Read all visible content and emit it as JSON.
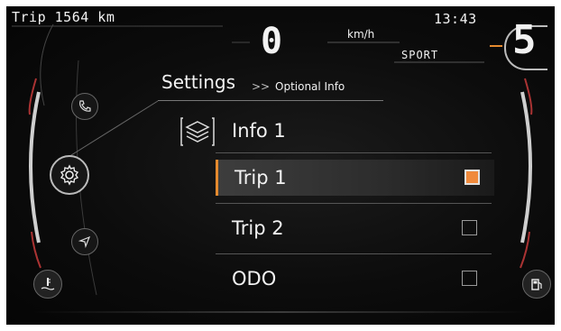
{
  "status": {
    "trip": "Trip 1564 km",
    "clock": "13:43",
    "speed_unit": "km/h",
    "ride_mode": "SPORT",
    "speed": "0",
    "gear": "5"
  },
  "breadcrumb": {
    "title": "Settings",
    "separator": ">>",
    "current": "Optional Info"
  },
  "menu": {
    "header": "Info 1",
    "items": [
      {
        "label": "Trip 1",
        "checked": true,
        "selected": true
      },
      {
        "label": "Trip  2",
        "checked": false,
        "selected": false
      },
      {
        "label": "ODO",
        "checked": false,
        "selected": false
      }
    ]
  },
  "left_icons": [
    "phone-icon",
    "settings-gear-icon",
    "navigation-arrow-icon",
    "coolant-temperature-icon"
  ],
  "right_icons": [
    "fuel-icon"
  ],
  "colors": {
    "accent": "#e58a2e",
    "checkbox_checked": "#f08a3c",
    "text": "#f2f2f2",
    "background": "#0c0c0c"
  }
}
